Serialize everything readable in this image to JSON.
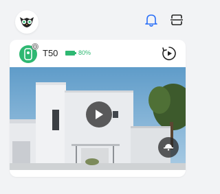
{
  "header": {
    "logo_icon": "owl-logo-icon",
    "notifications_icon": "bell-icon",
    "scan_icon": "scan-icon"
  },
  "device": {
    "name": "T50",
    "battery_level": 0.8,
    "battery_text": "80%",
    "status_color": "#2eb872",
    "device_icon": "camera-device-icon",
    "settings_icon": "gear-icon",
    "replay_icon": "playback-icon"
  },
  "preview": {
    "play_icon": "play-icon",
    "ptz_icon": "dome-camera-icon"
  },
  "colors": {
    "accent": "#2a6ff7",
    "battery": "#2eb872",
    "background": "#f2f3f5"
  }
}
